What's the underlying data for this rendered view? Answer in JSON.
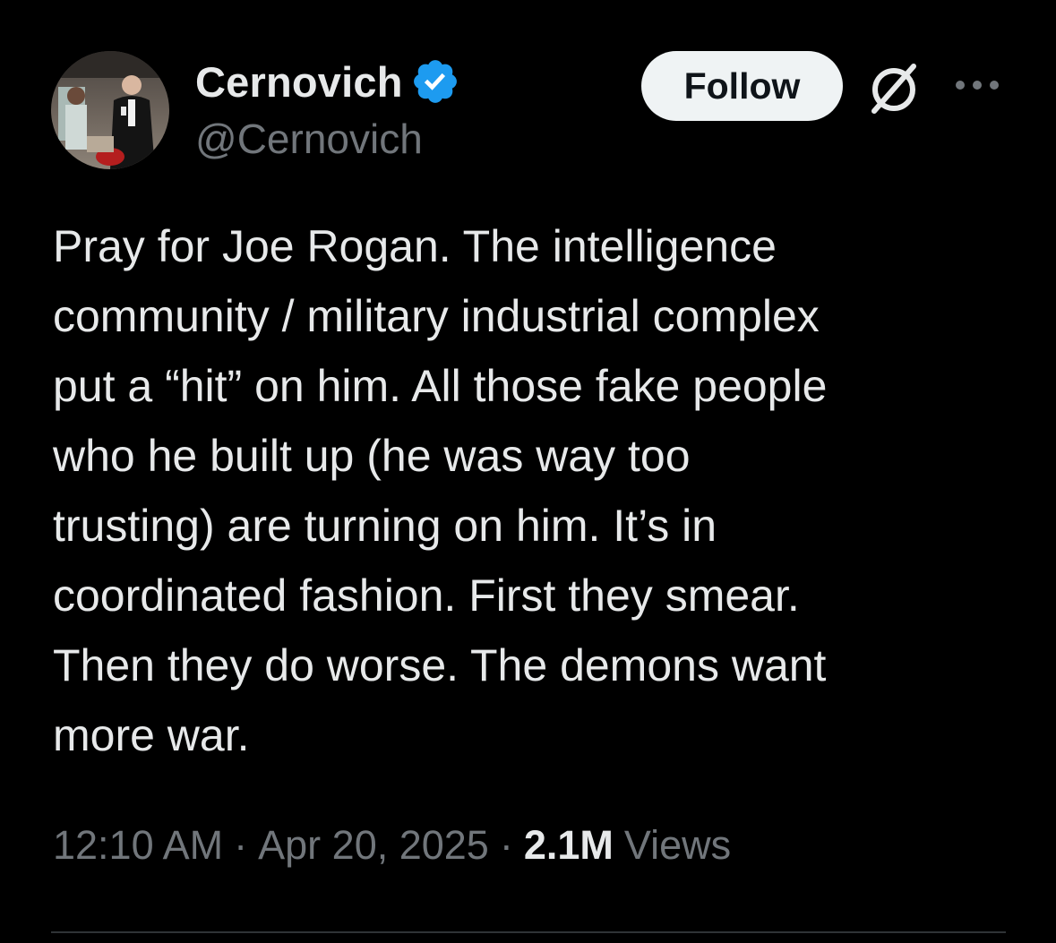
{
  "user": {
    "display_name": "Cernovich",
    "handle": "@Cernovich",
    "verified": true,
    "verified_color": "#1d9bf0"
  },
  "actions": {
    "follow_label": "Follow",
    "grok_icon": "grok-icon",
    "more_icon": "more-icon"
  },
  "tweet": {
    "text": "Pray for Joe Rogan. The intelligence\ncommunity / military industrial complex\nput a “hit” on him. All those fake people\nwho he built up (he was way too\ntrusting) are turning on him. It’s in\ncoordinated fashion. First they smear.\nThen they do worse. The demons want\nmore war.",
    "time": "12:10 AM",
    "separator": "·",
    "date": "Apr 20, 2025",
    "views_count": "2.1M",
    "views_label": "Views"
  },
  "colors": {
    "background": "#000000",
    "primary_text": "#e7e9ea",
    "secondary_text": "#71767b",
    "follow_bg": "#eff3f4",
    "divider": "#2f3336"
  }
}
